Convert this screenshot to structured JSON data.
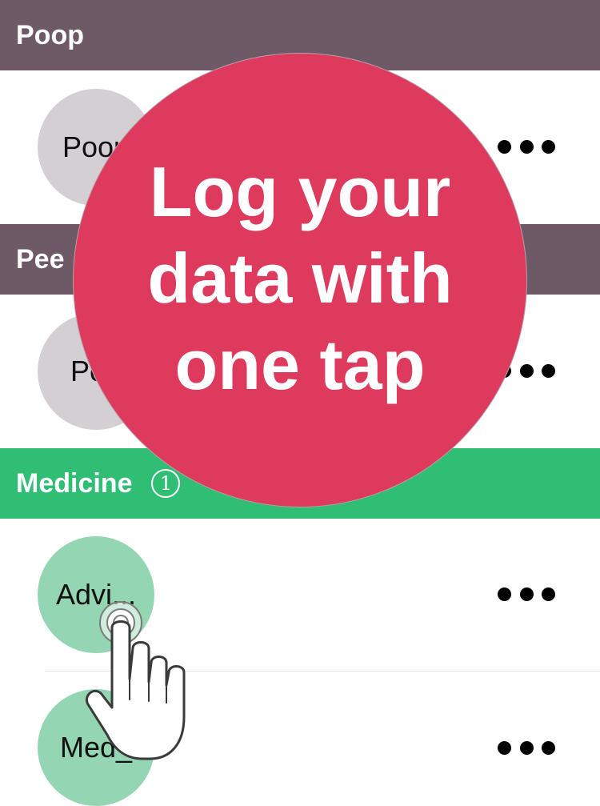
{
  "sections": {
    "poop": {
      "title": "Poop",
      "tag_label": "Poop"
    },
    "pee": {
      "title": "Pee",
      "tag_label": "Pee"
    },
    "medicine": {
      "title": "Medicine",
      "badge": "1",
      "tags": [
        {
          "label": "Advi..."
        },
        {
          "label": "Med_"
        }
      ]
    }
  },
  "overlay": {
    "message": "Log your data with one tap"
  },
  "icons": {
    "more": "more-dots-icon",
    "tap_hand": "tap-hand-icon"
  },
  "colors": {
    "plum_header": "#6e5a67",
    "green_header": "#2fbe74",
    "overlay_red": "#dd3a5d",
    "tag_grey": "#d3cfd3",
    "tag_green": "#94d6b3"
  }
}
